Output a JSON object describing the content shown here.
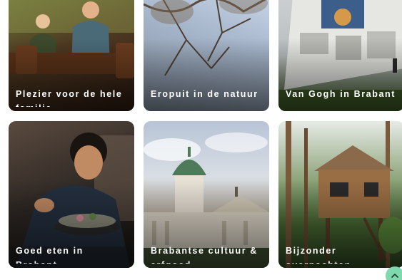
{
  "cards": [
    {
      "title": "Plezier voor de hele familie"
    },
    {
      "title": "Eropuit in de natuur"
    },
    {
      "title": "Van Gogh in Brabant"
    },
    {
      "title": "Goed eten in Brabant"
    },
    {
      "title": "Brabantse cultuur & erfgoed"
    },
    {
      "title": "Bijzonder overnachten"
    }
  ],
  "scroll_top": {
    "icon": "chevron-up-icon",
    "color": "#7ed9ae"
  }
}
